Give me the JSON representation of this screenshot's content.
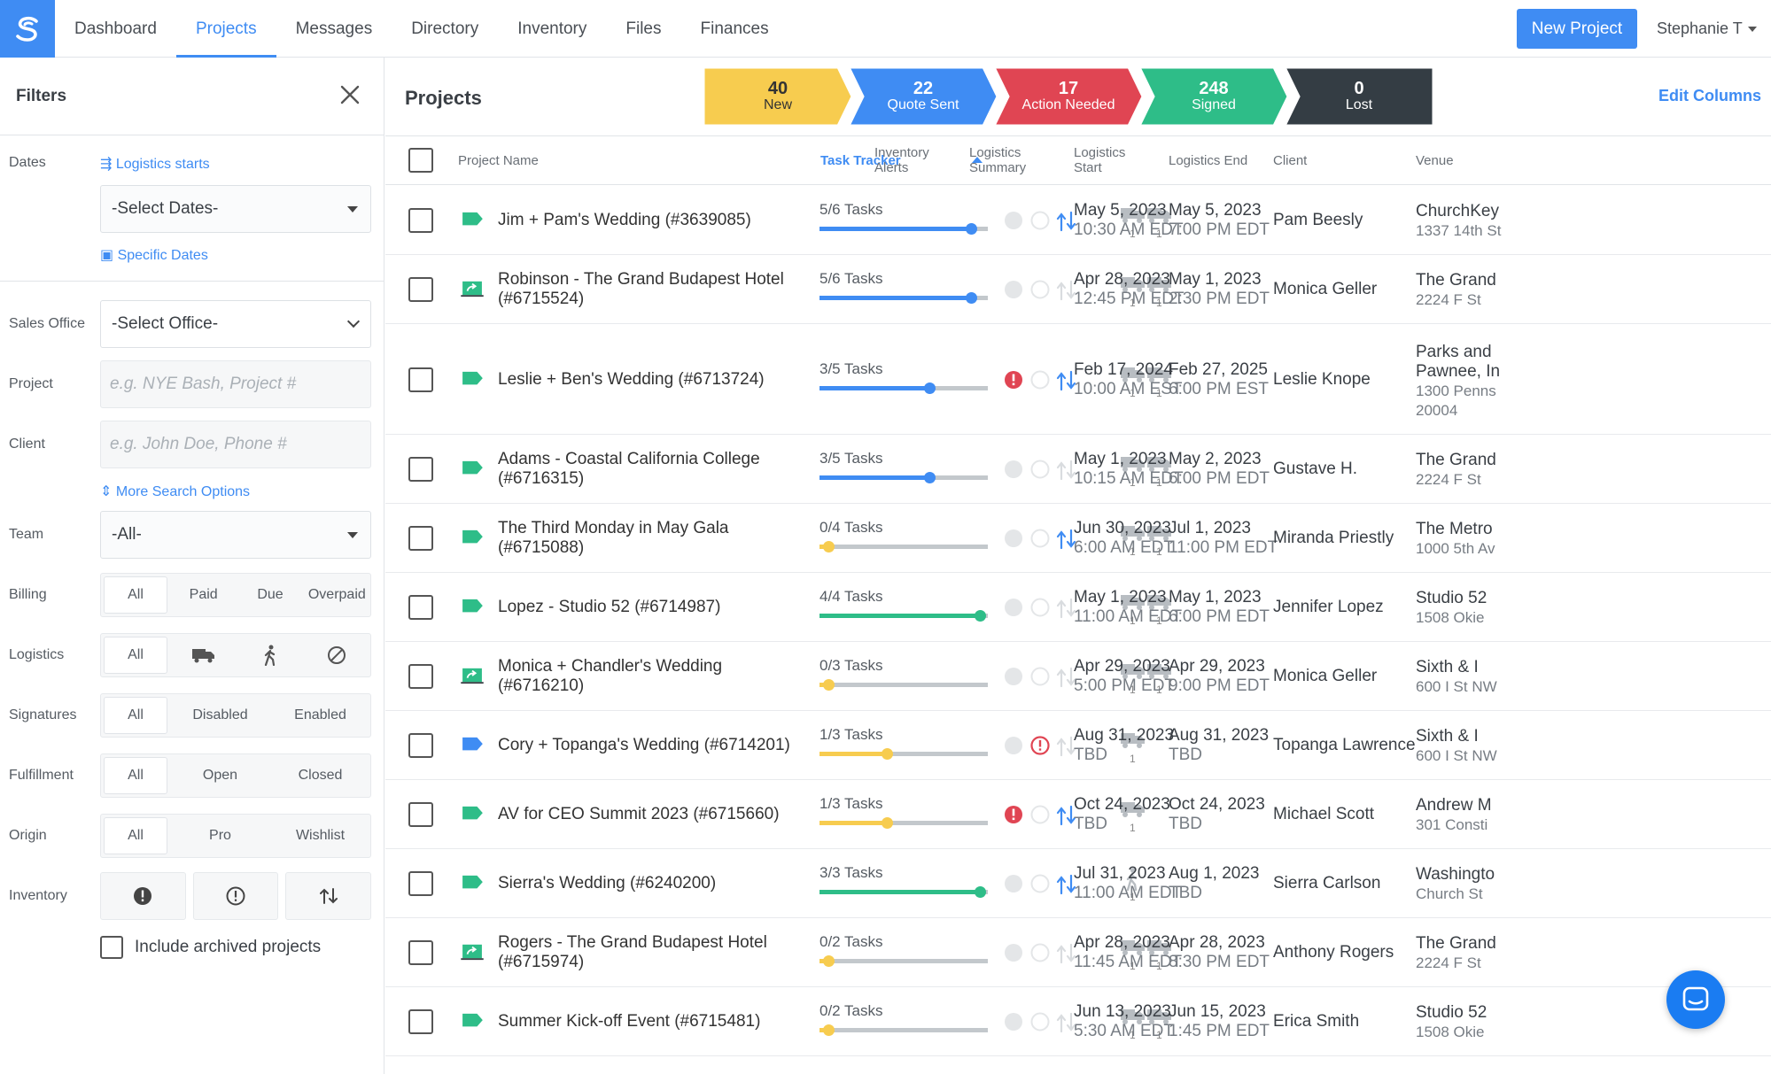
{
  "nav": {
    "logo": "logo-icon",
    "tabs": [
      {
        "label": "Dashboard"
      },
      {
        "label": "Projects",
        "active": true
      },
      {
        "label": "Messages"
      },
      {
        "label": "Directory"
      },
      {
        "label": "Inventory"
      },
      {
        "label": "Files"
      },
      {
        "label": "Finances"
      }
    ],
    "new_project": "New Project",
    "user": "Stephanie T"
  },
  "filters": {
    "title": "Filters",
    "dates_label": "Dates",
    "logistics_starts": "Logistics starts",
    "select_dates": "-Select Dates-",
    "specific_dates": "Specific Dates",
    "sales_office_label": "Sales Office",
    "select_office": "-Select Office-",
    "project_label": "Project",
    "project_placeholder": "e.g. NYE Bash, Project #",
    "client_label": "Client",
    "client_placeholder": "e.g. John Doe, Phone #",
    "more_search": "More Search Options",
    "team_label": "Team",
    "team_value": "-All-",
    "billing_label": "Billing",
    "billing_options": [
      "All",
      "Paid",
      "Due",
      "Overpaid"
    ],
    "logistics_label": "Logistics",
    "logistics_all": "All",
    "signatures_label": "Signatures",
    "signatures_options": [
      "All",
      "Disabled",
      "Enabled"
    ],
    "fulfillment_label": "Fulfillment",
    "fulfillment_options": [
      "All",
      "Open",
      "Closed"
    ],
    "origin_label": "Origin",
    "origin_options": [
      "All",
      "Pro",
      "Wishlist"
    ],
    "inventory_label": "Inventory",
    "archived_label": "Include archived projects"
  },
  "main": {
    "title": "Projects",
    "edit_columns": "Edit Columns",
    "stages": [
      {
        "count": "40",
        "label": "New",
        "color": "#f7cc4f",
        "text": "#333333"
      },
      {
        "count": "22",
        "label": "Quote Sent",
        "color": "#3f8cf3",
        "text": "#ffffff"
      },
      {
        "count": "17",
        "label": "Action Needed",
        "color": "#e04553",
        "text": "#ffffff"
      },
      {
        "count": "248",
        "label": "Signed",
        "color": "#2ebd88",
        "text": "#ffffff"
      },
      {
        "count": "0",
        "label": "Lost",
        "color": "#343d44",
        "text": "#ffffff"
      }
    ],
    "columns": {
      "project_name": "Project Name",
      "task_tracker": "Task Tracker",
      "inventory_alerts_1": "Inventory",
      "inventory_alerts_2": "Alerts",
      "logistics_summary_1": "Logistics",
      "logistics_summary_2": "Summary",
      "logistics_start_1": "Logistics",
      "logistics_start_2": "Start",
      "logistics_end": "Logistics End",
      "client": "Client",
      "venue": "Venue"
    }
  },
  "colors": {
    "accent": "#3f8cf3",
    "green": "#2ebd88",
    "yellow": "#f7cc4f",
    "red": "#e04553"
  },
  "rows": [
    {
      "name": "Jim + Pam's Wedding (#3639085)",
      "tag": "green",
      "tasks": "5/6 Tasks",
      "progress": 0.9,
      "bar": "blue",
      "alerts": [
        "off",
        "off",
        "on"
      ],
      "trucks": 2,
      "start_date": "May 5, 2023",
      "start_time": "10:30 AM EDT",
      "end_date": "May 5, 2023",
      "end_time": "7:00 PM EDT",
      "client": "Pam Beesly",
      "venue": "ChurchKey",
      "venue_addr": "1337 14th St"
    },
    {
      "name": "Robinson - The Grand Budapest Hotel (#6715524)",
      "tag": "share",
      "tasks": "5/6 Tasks",
      "progress": 0.9,
      "bar": "blue",
      "alerts": [
        "off",
        "off",
        "off"
      ],
      "trucks": 2,
      "start_date": "Apr 28, 2023",
      "start_time": "12:45 PM EDT",
      "end_date": "May 1, 2023",
      "end_time": "2:30 PM EDT",
      "client": "Monica Geller",
      "venue": "The Grand",
      "venue_addr": "2224 F St"
    },
    {
      "name": "Leslie + Ben's Wedding (#6713724)",
      "tag": "green",
      "tasks": "3/5 Tasks",
      "progress": 0.65,
      "bar": "blue",
      "alerts": [
        "red",
        "off",
        "on"
      ],
      "trucks": 2,
      "start_date": "Feb 17, 2024",
      "start_time": "10:00 AM EST",
      "end_date": "Feb 27, 2025",
      "end_time": "6:00 PM EST",
      "client": "Leslie Knope",
      "venue": "Parks and",
      "venue_2": "Pawnee, In",
      "venue_addr": "1300 Penns",
      "venue_addr2": "20004"
    },
    {
      "name": "Adams - Coastal California College (#6716315)",
      "tag": "green",
      "tasks": "3/5 Tasks",
      "progress": 0.65,
      "bar": "blue",
      "alerts": [
        "off",
        "off",
        "off"
      ],
      "trucks": 2,
      "start_date": "May 1, 2023",
      "start_time": "10:15 AM EDT",
      "end_date": "May 2, 2023",
      "end_time": "6:00 PM EDT",
      "client": "Gustave H.",
      "venue": "The Grand",
      "venue_addr": "2224 F St"
    },
    {
      "name": "The Third Monday in May Gala (#6715088)",
      "tag": "green",
      "tasks": "0/4 Tasks",
      "progress": 0.05,
      "bar": "yellow",
      "alerts": [
        "off",
        "off",
        "on"
      ],
      "trucks": 2,
      "start_date": "Jun 30, 2023",
      "start_time": "6:00 AM EDT",
      "end_date": "Jul 1, 2023",
      "end_time": "11:00 PM EDT",
      "client": "Miranda Priestly",
      "venue": "The Metro",
      "venue_addr": "1000 5th Av"
    },
    {
      "name": "Lopez - Studio 52 (#6714987)",
      "tag": "green",
      "tasks": "4/4 Tasks",
      "progress": 0.95,
      "bar": "green",
      "alerts": [
        "off",
        "off",
        "off"
      ],
      "trucks": 2,
      "start_date": "May 1, 2023",
      "start_time": "11:00 AM EDT",
      "end_date": "May 1, 2023",
      "end_time": "6:00 PM EDT",
      "client": "Jennifer Lopez",
      "venue": "Studio 52",
      "venue_addr": "1508 Okie"
    },
    {
      "name": "Monica + Chandler's Wedding (#6716210)",
      "tag": "share",
      "tasks": "0/3 Tasks",
      "progress": 0.05,
      "bar": "yellow",
      "alerts": [
        "off",
        "off",
        "off"
      ],
      "trucks": 2,
      "start_date": "Apr 29, 2023",
      "start_time": "5:00 PM EDT",
      "end_date": "Apr 29, 2023",
      "end_time": "9:00 PM EDT",
      "client": "Monica Geller",
      "venue": "Sixth & I",
      "venue_addr": "600 I St NW"
    },
    {
      "name": "Cory + Topanga's Wedding (#6714201)",
      "tag": "blue",
      "tasks": "1/3 Tasks",
      "progress": 0.4,
      "bar": "yellow",
      "alerts": [
        "off",
        "redring",
        "off"
      ],
      "trucks": 1,
      "start_date": "Aug 31, 2023",
      "start_time": "TBD",
      "end_date": "Aug 31, 2023",
      "end_time": "TBD",
      "client": "Topanga Lawrence",
      "venue": "Sixth & I",
      "venue_addr": "600 I St NW"
    },
    {
      "name": "AV for CEO Summit 2023 (#6715660)",
      "tag": "green",
      "tasks": "1/3 Tasks",
      "progress": 0.4,
      "bar": "yellow",
      "alerts": [
        "red",
        "off",
        "on"
      ],
      "trucks": 1,
      "start_date": "Oct 24, 2023",
      "start_time": "TBD",
      "end_date": "Oct 24, 2023",
      "end_time": "TBD",
      "client": "Michael Scott",
      "venue": "Andrew M",
      "venue_addr": "301 Consti"
    },
    {
      "name": "Sierra's Wedding (#6240200)",
      "tag": "green",
      "tasks": "3/3 Tasks",
      "progress": 0.95,
      "bar": "green",
      "alerts": [
        "off",
        "off",
        "on"
      ],
      "trucks": 0,
      "walker": true,
      "start_date": "Jul 31, 2023",
      "start_time": "11:00 AM EDT",
      "end_date": "Aug 1, 2023",
      "end_time": "TBD",
      "client": "Sierra Carlson",
      "venue": "Washingto",
      "venue_addr": "Church St"
    },
    {
      "name": "Rogers - The Grand Budapest Hotel (#6715974)",
      "tag": "share",
      "tasks": "0/2 Tasks",
      "progress": 0.05,
      "bar": "yellow",
      "alerts": [
        "off",
        "off",
        "off"
      ],
      "trucks": 2,
      "start_date": "Apr 28, 2023",
      "start_time": "11:45 AM EDT",
      "end_date": "Apr 28, 2023",
      "end_time": "8:30 PM EDT",
      "client": "Anthony Rogers",
      "venue": "The Grand",
      "venue_addr": "2224 F St"
    },
    {
      "name": "Summer Kick-off Event (#6715481)",
      "tag": "green",
      "tasks": "0/2 Tasks",
      "progress": 0.05,
      "bar": "yellow",
      "alerts": [
        "off",
        "off",
        "off"
      ],
      "trucks": 2,
      "start_date": "Jun 13, 2023",
      "start_time": "5:30 AM EDT",
      "end_date": "Jun 15, 2023",
      "end_time": "1:45 PM EDT",
      "client": "Erica Smith",
      "venue": "Studio 52",
      "venue_addr": "1508 Okie"
    }
  ],
  "truck_count_label": "1",
  "chat": "chat-icon"
}
